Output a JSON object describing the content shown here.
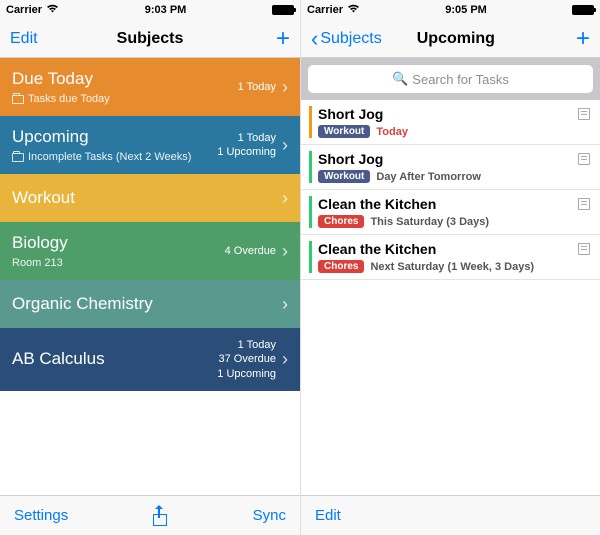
{
  "left": {
    "status": {
      "carrier": "Carrier",
      "time": "9:03 PM"
    },
    "nav": {
      "edit": "Edit",
      "title": "Subjects",
      "add": "+"
    },
    "subjects": [
      {
        "title": "Due Today",
        "subtitle": "Tasks due Today",
        "meta": [
          "1 Today"
        ],
        "folder": true,
        "color": "c-orange"
      },
      {
        "title": "Upcoming",
        "subtitle": "Incomplete Tasks (Next 2 Weeks)",
        "meta": [
          "1 Today",
          "1 Upcoming"
        ],
        "folder": true,
        "color": "c-blue"
      },
      {
        "title": "Workout",
        "subtitle": "",
        "meta": [],
        "folder": false,
        "color": "c-yellow"
      },
      {
        "title": "Biology",
        "subtitle": "Room 213",
        "meta": [
          "4 Overdue"
        ],
        "folder": false,
        "color": "c-green"
      },
      {
        "title": "Organic Chemistry",
        "subtitle": "",
        "meta": [],
        "folder": false,
        "color": "c-teal"
      },
      {
        "title": "AB Calculus",
        "subtitle": "",
        "meta": [
          "1 Today",
          "37 Overdue",
          "1 Upcoming"
        ],
        "folder": false,
        "color": "c-navy"
      }
    ],
    "toolbar": {
      "settings": "Settings",
      "sync": "Sync"
    }
  },
  "right": {
    "status": {
      "carrier": "Carrier",
      "time": "9:05 PM"
    },
    "nav": {
      "back": "Subjects",
      "title": "Upcoming",
      "add": "+"
    },
    "search": {
      "placeholder": "Search for Tasks"
    },
    "tasks": [
      {
        "title": "Short Jog",
        "tag": "Workout",
        "tagClass": "tag-workout",
        "due": "Today",
        "dueClass": "due-today",
        "stripe": "stripe-orange",
        "recurring": true
      },
      {
        "title": "Short Jog",
        "tag": "Workout",
        "tagClass": "tag-workout",
        "due": "Day After Tomorrow",
        "dueClass": "due-normal",
        "stripe": "stripe-green",
        "recurring": true
      },
      {
        "title": "Clean the Kitchen",
        "tag": "Chores",
        "tagClass": "tag-chores",
        "due": "This Saturday (3 Days)",
        "dueClass": "due-normal",
        "stripe": "stripe-green",
        "recurring": true
      },
      {
        "title": "Clean the Kitchen",
        "tag": "Chores",
        "tagClass": "tag-chores",
        "due": "Next Saturday (1 Week, 3 Days)",
        "dueClass": "due-normal",
        "stripe": "stripe-green",
        "recurring": true
      }
    ],
    "toolbar": {
      "edit": "Edit"
    }
  }
}
